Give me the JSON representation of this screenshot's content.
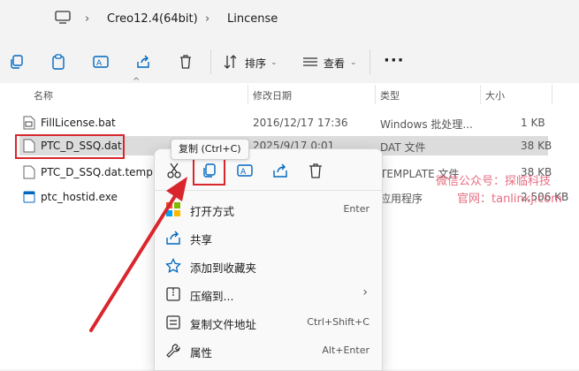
{
  "address": {
    "crumbs": [
      "Creo12.4(64bit)",
      "Lincense"
    ]
  },
  "toolbar": {
    "sort_label": "排序",
    "view_label": "查看"
  },
  "columns": [
    "名称",
    "修改日期",
    "类型",
    "大小"
  ],
  "files": [
    {
      "name": "FillLicense.bat",
      "date": "2016/12/17 17:36",
      "type": "Windows 批处理...",
      "size": "1 KB"
    },
    {
      "name": "PTC_D_SSQ.dat",
      "date": "2025/9/17 0:01",
      "type": "DAT 文件",
      "size": "38 KB"
    },
    {
      "name": "PTC_D_SSQ.dat.templa",
      "date": "",
      "type": "TEMPLATE 文件",
      "size": "38 KB"
    },
    {
      "name": "ptc_hostid.exe",
      "date": "",
      "type": "应用程序",
      "size": "2,506 KB"
    }
  ],
  "tooltip": "复制 (Ctrl+C)",
  "context_menu": {
    "items": [
      {
        "label": "打开方式",
        "accel": "Enter"
      },
      {
        "label": "共享",
        "accel": ""
      },
      {
        "label": "添加到收藏夹",
        "accel": ""
      },
      {
        "label": "压缩到...",
        "accel": ""
      },
      {
        "label": "复制文件地址",
        "accel": "Ctrl+Shift+C"
      },
      {
        "label": "属性",
        "accel": "Alt+Enter"
      }
    ]
  },
  "watermark": {
    "line1": "微信公众号：探临科技",
    "line2": "官网：tanlinkj.com"
  },
  "colors": {
    "accent": "#0067c0",
    "highlight": "#d9262c",
    "selection": "#dcdcdc"
  }
}
